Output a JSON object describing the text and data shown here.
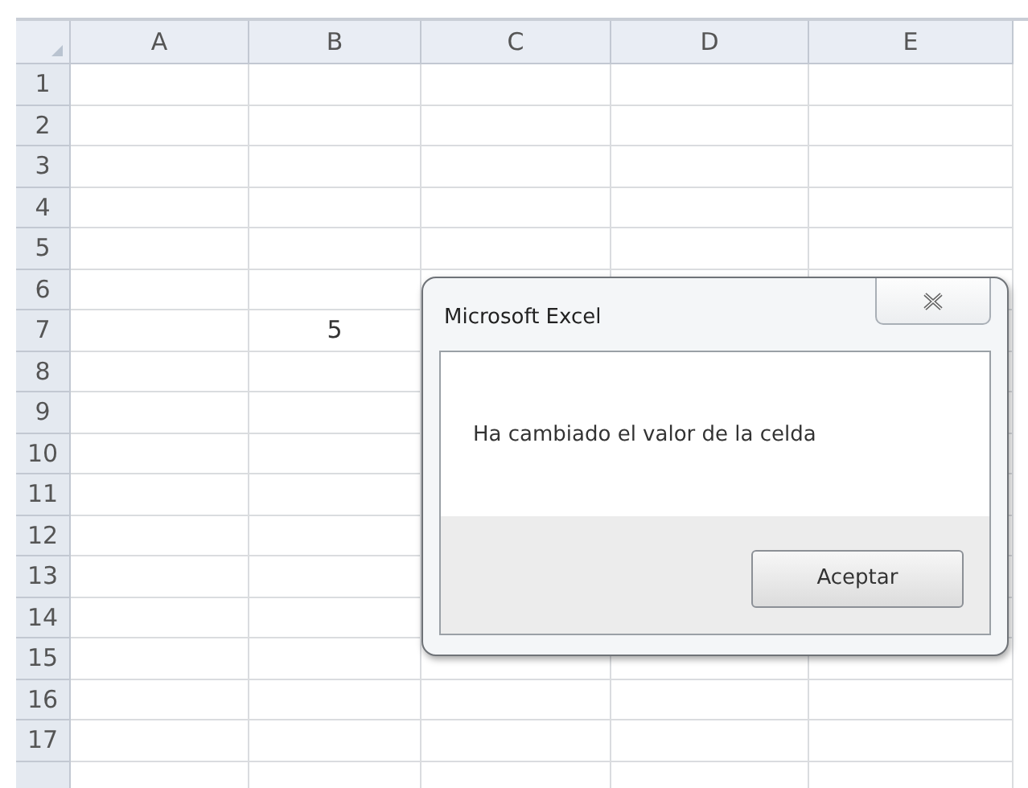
{
  "sheet": {
    "columns": [
      "A",
      "B",
      "C",
      "D",
      "E"
    ],
    "rows": [
      {
        "label": "1"
      },
      {
        "label": "2"
      },
      {
        "label": "3"
      },
      {
        "label": "4"
      },
      {
        "label": "5"
      },
      {
        "label": "6"
      },
      {
        "label": "7",
        "cells": {
          "B": "5"
        }
      },
      {
        "label": "8"
      },
      {
        "label": "9"
      },
      {
        "label": "10"
      },
      {
        "label": "11"
      },
      {
        "label": "12"
      },
      {
        "label": "13"
      },
      {
        "label": "14"
      },
      {
        "label": "15"
      },
      {
        "label": "16"
      },
      {
        "label": "17"
      }
    ]
  },
  "dialog": {
    "title": "Microsoft Excel",
    "message": "Ha cambiado el valor de la celda",
    "buttons": [
      "Aceptar"
    ]
  }
}
